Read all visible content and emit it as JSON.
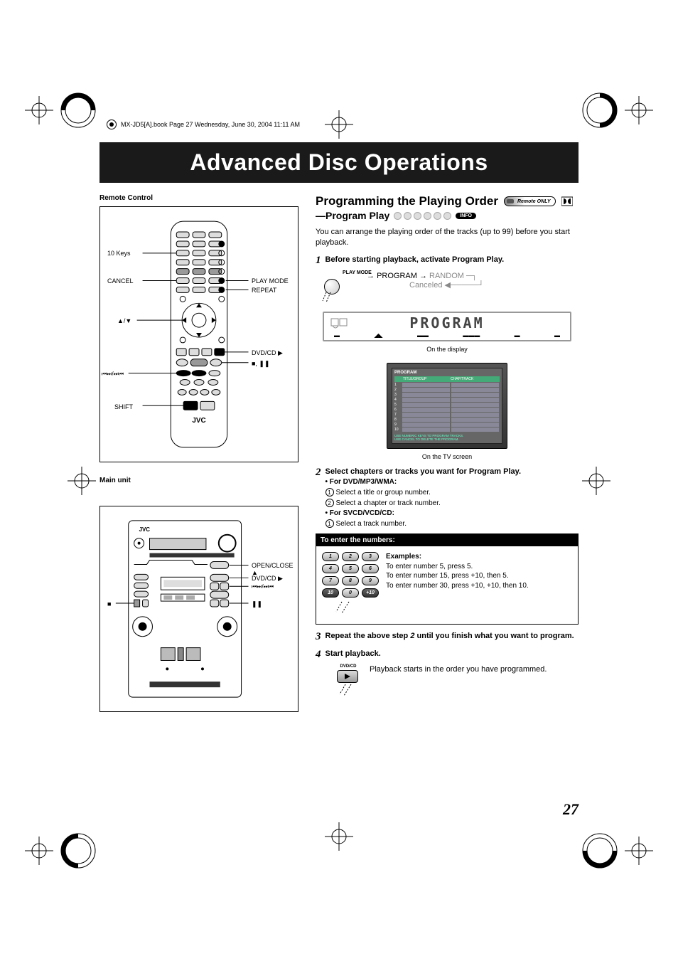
{
  "meta": {
    "header": "MX-JD5[A].book  Page 27  Wednesday, June 30, 2004  11:11 AM"
  },
  "title": "Advanced Disc Operations",
  "left": {
    "remote_label": "Remote Control",
    "main_unit_label": "Main unit",
    "remote_labels": {
      "ten_keys": "10 Keys",
      "cancel": "CANCEL",
      "up_down": "▲/▼",
      "prev_next": "⏮⏭/⏭⏮",
      "shift": "SHIFT",
      "play_mode": "PLAY MODE",
      "repeat": "REPEAT",
      "dvd_cd": "DVD/CD ▶",
      "stop_pause": "■, ❚❚",
      "jvc": "JVC"
    },
    "main_labels": {
      "open_close": "OPEN/CLOSE ▲",
      "dvd_cd": "DVD/CD ▶",
      "skip": "⏮⏭/⏭⏮",
      "pause": "❚❚",
      "stop": "■",
      "jvc": "JVC"
    }
  },
  "right": {
    "section_heading": "Programming the Playing Order",
    "remote_only": "Remote ONLY",
    "sub_heading": "—Program Play",
    "info_badge": "INFO",
    "intro": "You can arrange the playing order of the tracks (up to 99) before you start playback.",
    "step1": {
      "n": "1",
      "text": "Before starting playback, activate Program Play.",
      "pm_label": "PLAY MODE",
      "flow_program": "PROGRAM",
      "flow_random": "RANDOM",
      "flow_canceled": "Canceled",
      "display_text": "PROGRAM",
      "display_caption": "On the display"
    },
    "tv": {
      "title": "PROGRAM",
      "col1": "TITLE/GROUP",
      "col2": "CHAP/TRACK",
      "rows": 10,
      "footer1": "USE NUMERIC KEYS TO PROGRAM TRACKS.",
      "footer2": "USE CANCEL TO DELETE THE PROGRAM.",
      "caption": "On the TV screen"
    },
    "step2": {
      "n": "2",
      "text": "Select chapters or tracks you want for Program Play.",
      "b1": "• For DVD/MP3/WMA:",
      "b1_1": "Select a title or group number.",
      "b1_2": "Select a chapter or track number.",
      "b2": "• For SVCD/VCD/CD:",
      "b2_1": "Select a track number."
    },
    "enter": {
      "head": "To enter the numbers:",
      "keys": [
        [
          "1",
          "2",
          "3"
        ],
        [
          "4",
          "5",
          "6"
        ],
        [
          "7",
          "8",
          "9"
        ],
        [
          "10",
          "0",
          "+10"
        ]
      ],
      "examples_title": "Examples:",
      "ex1": "To enter number 5, press 5.",
      "ex2": "To enter number 15, press +10, then 5.",
      "ex3": "To enter number 30, press +10, +10, then 10."
    },
    "step3": {
      "n": "3",
      "text_a": "Repeat the above step ",
      "text_b": "2",
      "text_c": " until you finish what you want to program."
    },
    "step4": {
      "n": "4",
      "text": "Start playback.",
      "btn_label": "DVD/CD",
      "desc": "Playback starts in the order you have programmed."
    }
  },
  "page_number": "27"
}
